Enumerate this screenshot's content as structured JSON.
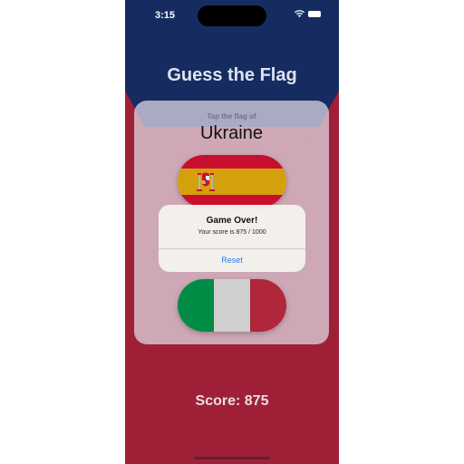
{
  "status_bar": {
    "time": "3:15"
  },
  "header": {
    "title": "Guess the Flag"
  },
  "card": {
    "prompt": "Tap the flag of",
    "country": "Ukraine"
  },
  "flags": [
    {
      "name": "spain-flag",
      "colors": [
        "#c8102e",
        "#d4a10c",
        "#c8102e"
      ]
    },
    {
      "name": "italy-flag",
      "colors": [
        "#008c45",
        "#cfcfcf",
        "#b0263a"
      ]
    }
  ],
  "alert": {
    "title": "Game Over!",
    "message": "Your score is 875 / 1000",
    "button": "Reset"
  },
  "score": {
    "label": "Score: 875"
  },
  "colors": {
    "navy": "#162c61",
    "red": "#9f2036",
    "accent": "#2a7ae0"
  }
}
